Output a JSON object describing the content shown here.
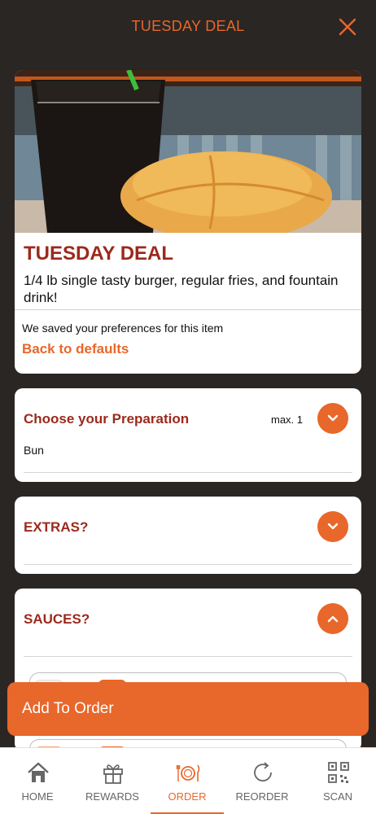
{
  "header": {
    "title": "TUESDAY DEAL",
    "close_icon": "close-icon"
  },
  "hero": {
    "image_desc_icon": "burger-and-drink-photo",
    "title": "TUESDAY DEAL",
    "description": "1/4 lb single tasty burger, regular fries, and fountain drink!",
    "saved_message": "We saved your preferences for this item",
    "back_to_defaults": "Back to defaults"
  },
  "sections": {
    "preparation": {
      "title": "Choose your Preparation",
      "max": "max. 1",
      "option": "Bun",
      "state": "collapsed"
    },
    "extras": {
      "title": "EXTRAS?",
      "state": "collapsed"
    },
    "sauces": {
      "title": "SAUCES?",
      "state": "expanded"
    }
  },
  "add_to_order": "Add To Order",
  "tabbar": {
    "tabs": [
      {
        "label": "HOME",
        "icon": "home-icon"
      },
      {
        "label": "REWARDS",
        "icon": "gift-icon"
      },
      {
        "label": "ORDER",
        "icon": "plate-utensils-icon"
      },
      {
        "label": "REORDER",
        "icon": "refresh-icon"
      },
      {
        "label": "SCAN",
        "icon": "qr-code-icon"
      }
    ],
    "active": "ORDER"
  },
  "colors": {
    "accent": "#e8672a",
    "title_red": "#9b2a1c",
    "background": "#2a2624"
  }
}
